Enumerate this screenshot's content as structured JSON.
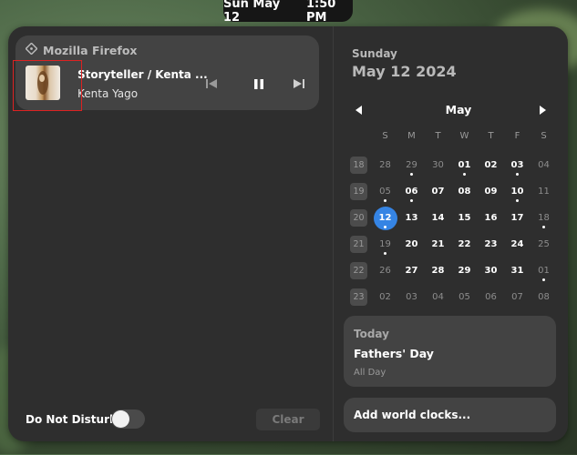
{
  "topbar": {
    "date": "Sun May 12",
    "time": "1:50 PM"
  },
  "media": {
    "app_name": "Mozilla Firefox",
    "app_icon": "firefox-diamond-icon",
    "title": "Storyteller / Kenta ...",
    "artist": "Kenta Yago",
    "controls": [
      "previous-icon",
      "pause-icon",
      "next-icon"
    ]
  },
  "notifications": {
    "dnd_label": "Do Not Disturb",
    "dnd_enabled": false,
    "clear_label": "Clear"
  },
  "calendar": {
    "weekday": "Sunday",
    "full_date": "May 12 2024",
    "month": "May",
    "day_headers": [
      "S",
      "M",
      "T",
      "W",
      "T",
      "F",
      "S"
    ],
    "weeks": [
      {
        "week": "18",
        "days": [
          {
            "d": "28",
            "other": true,
            "dot": false
          },
          {
            "d": "29",
            "other": true,
            "dot": true
          },
          {
            "d": "30",
            "other": true,
            "dot": false
          },
          {
            "d": "01",
            "other": false,
            "dot": true
          },
          {
            "d": "02",
            "other": false,
            "dot": false
          },
          {
            "d": "03",
            "other": false,
            "dot": true
          },
          {
            "d": "04",
            "other": true,
            "dot": false
          }
        ]
      },
      {
        "week": "19",
        "days": [
          {
            "d": "05",
            "other": true,
            "dot": true
          },
          {
            "d": "06",
            "other": false,
            "dot": true
          },
          {
            "d": "07",
            "other": false,
            "dot": false
          },
          {
            "d": "08",
            "other": false,
            "dot": false
          },
          {
            "d": "09",
            "other": false,
            "dot": false
          },
          {
            "d": "10",
            "other": false,
            "dot": true
          },
          {
            "d": "11",
            "other": true,
            "dot": false
          }
        ]
      },
      {
        "week": "20",
        "days": [
          {
            "d": "12",
            "other": false,
            "dot": true,
            "today": true
          },
          {
            "d": "13",
            "other": false,
            "dot": false
          },
          {
            "d": "14",
            "other": false,
            "dot": false
          },
          {
            "d": "15",
            "other": false,
            "dot": false
          },
          {
            "d": "16",
            "other": false,
            "dot": false
          },
          {
            "d": "17",
            "other": false,
            "dot": false
          },
          {
            "d": "18",
            "other": true,
            "dot": true
          }
        ]
      },
      {
        "week": "21",
        "days": [
          {
            "d": "19",
            "other": true,
            "dot": true
          },
          {
            "d": "20",
            "other": false,
            "dot": false
          },
          {
            "d": "21",
            "other": false,
            "dot": false
          },
          {
            "d": "22",
            "other": false,
            "dot": false
          },
          {
            "d": "23",
            "other": false,
            "dot": false
          },
          {
            "d": "24",
            "other": false,
            "dot": false
          },
          {
            "d": "25",
            "other": true,
            "dot": false
          }
        ]
      },
      {
        "week": "22",
        "days": [
          {
            "d": "26",
            "other": true,
            "dot": false
          },
          {
            "d": "27",
            "other": false,
            "dot": false
          },
          {
            "d": "28",
            "other": false,
            "dot": false
          },
          {
            "d": "29",
            "other": false,
            "dot": false
          },
          {
            "d": "30",
            "other": false,
            "dot": false
          },
          {
            "d": "31",
            "other": false,
            "dot": false
          },
          {
            "d": "01",
            "other": true,
            "dot": true
          }
        ]
      },
      {
        "week": "23",
        "days": [
          {
            "d": "02",
            "other": true,
            "dot": false
          },
          {
            "d": "03",
            "other": true,
            "dot": false
          },
          {
            "d": "04",
            "other": true,
            "dot": false
          },
          {
            "d": "05",
            "other": true,
            "dot": false
          },
          {
            "d": "06",
            "other": true,
            "dot": false
          },
          {
            "d": "07",
            "other": true,
            "dot": false
          },
          {
            "d": "08",
            "other": true,
            "dot": false
          }
        ]
      }
    ]
  },
  "events": {
    "header": "Today",
    "items": [
      {
        "title": "Fathers' Day",
        "time": "All Day"
      }
    ]
  },
  "world_clocks": {
    "label": "Add world clocks..."
  },
  "colors": {
    "accent": "#3584e4",
    "panel": "#2e2e2e",
    "card": "#434343"
  }
}
